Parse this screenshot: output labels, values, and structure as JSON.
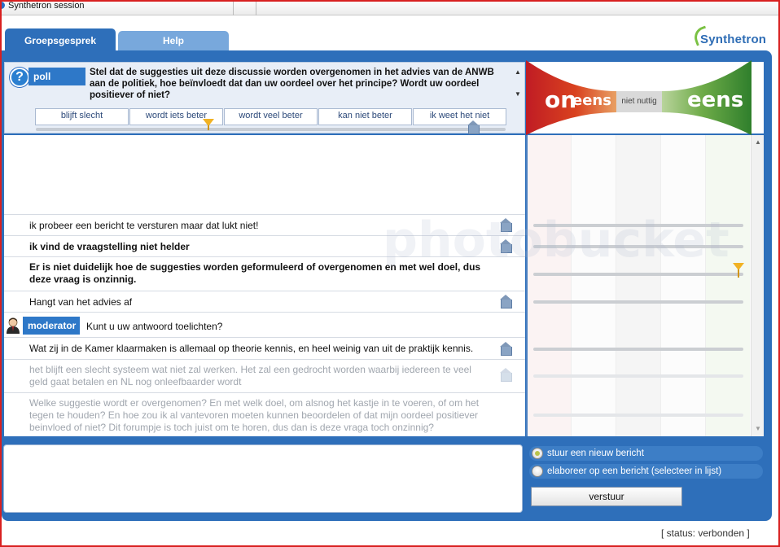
{
  "window": {
    "title": "Synthetron session"
  },
  "tabs": [
    {
      "label": "Groepsgesprek"
    },
    {
      "label": "Help"
    }
  ],
  "logo": {
    "text": "Synthetron"
  },
  "poll": {
    "label": "poll",
    "question": "Stel dat de suggesties uit deze discussie worden overgenomen in het advies van de ANWB aan de politiek, hoe beïnvloedt dat dan uw oordeel over het principe? Wordt uw oordeel positiever of niet?",
    "options": [
      "blijft slecht",
      "wordt iets beter",
      "wordt veel beter",
      "kan niet beter",
      "ik weet het niet"
    ],
    "selected_option": "wordt iets beter"
  },
  "scale": {
    "left_a": "on",
    "left_b": "eens",
    "middle": "niet nuttig",
    "right": "eens",
    "colors": {
      "red": "#c8202a",
      "green": "#3f8a2e"
    }
  },
  "messages": [
    {
      "text": "ik probeer een bericht te versturen maar dat lukt niet!"
    },
    {
      "text": "ik vind de vraagstelling niet helder"
    },
    {
      "text": "Er is niet duidelijk hoe de suggesties worden geformuleerd of overgenomen en met wel doel, dus deze vraag is onzinnig."
    },
    {
      "text": "Hangt van het advies af"
    },
    {
      "text": "Wat zij in de Kamer klaarmaken is allemaal op theorie kennis, en heel weinig van uit de praktijk kennis."
    },
    {
      "text": "het blijft een slecht systeem wat niet zal werken. Het zal een gedrocht worden waarbij iedereen te veel geld gaat betalen en NL nog onleefbaarder wordt"
    },
    {
      "text": "Welke suggestie wordt er overgenomen? En met welk doel, om alsnog het kastje in te voeren, of om het tegen te houden? En hoe zou ik al vantevoren moeten kunnen beoordelen of dat mijn oordeel positiever beinvloed of niet? Dit forumpje is toch juist om te horen, dus dan is deze vraga toch onzinnig?"
    }
  ],
  "moderator": {
    "label": "moderator",
    "text": "Kunt u uw antwoord toelichten?"
  },
  "compose": {
    "options": [
      {
        "label": "stuur een nieuw bericht",
        "selected": true
      },
      {
        "label": "elaboreer op een bericht (selecteer in lijst)",
        "selected": false
      }
    ],
    "send_label": "verstuur"
  },
  "status": {
    "text": "[ status: verbonden ]"
  },
  "watermark": {
    "text": "photobucket"
  }
}
